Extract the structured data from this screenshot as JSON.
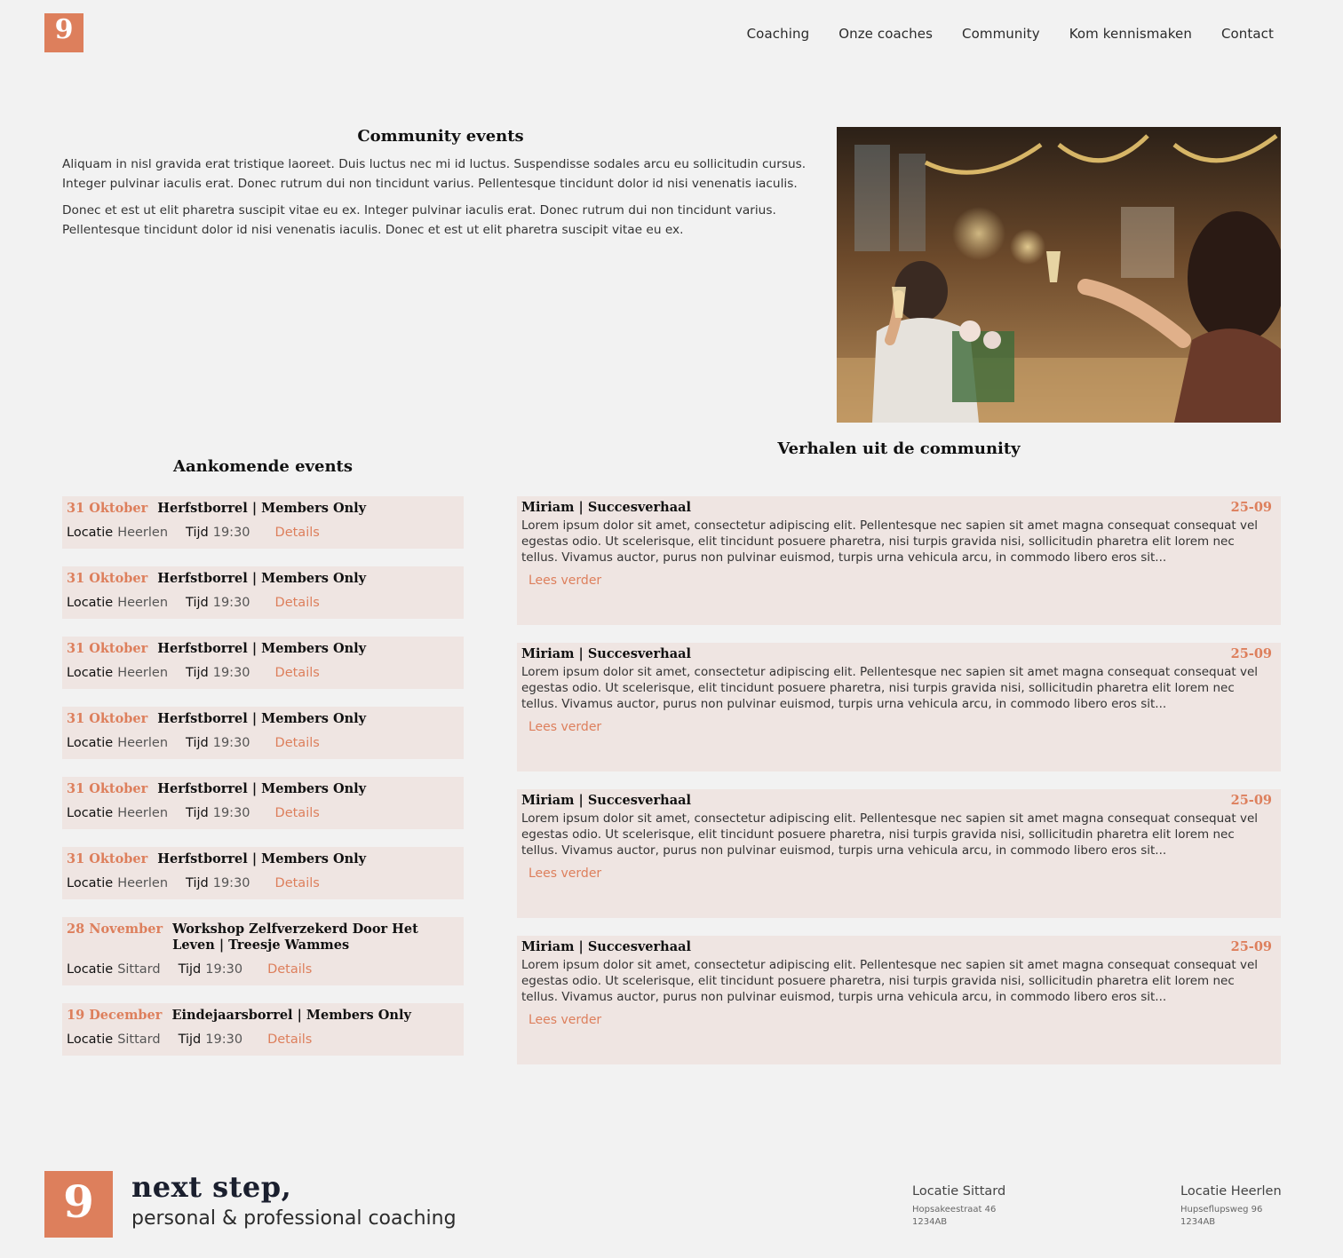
{
  "header": {
    "logo_glyph": "9",
    "nav": [
      "Coaching",
      "Onze coaches",
      "Community",
      "Kom kennismaken",
      "Contact"
    ]
  },
  "intro": {
    "title": "Community events",
    "paragraphs": [
      "Aliquam in nisl gravida erat tristique laoreet. Duis luctus nec mi id luctus. Suspendisse sodales arcu eu sollicitudin cursus. Integer pulvinar iaculis erat. Donec rutrum dui non tincidunt varius. Pellentesque tincidunt dolor id nisi venenatis iaculis.",
      "Donec et est ut elit pharetra suscipit vitae eu ex. Integer pulvinar iaculis erat. Donec rutrum dui non tincidunt varius. Pellentesque tincidunt dolor id nisi venenatis iaculis. Donec et est ut elit pharetra suscipit vitae eu ex."
    ]
  },
  "events": {
    "title": "Aankomende events",
    "label_location": "Locatie",
    "label_time": "Tijd",
    "details_label": "Details",
    "items": [
      {
        "date": "31 Oktober",
        "name": "Herfstborrel | Members Only",
        "location": "Heerlen",
        "time": "19:30"
      },
      {
        "date": "31 Oktober",
        "name": "Herfstborrel | Members Only",
        "location": "Heerlen",
        "time": "19:30"
      },
      {
        "date": "31 Oktober",
        "name": "Herfstborrel | Members Only",
        "location": "Heerlen",
        "time": "19:30"
      },
      {
        "date": "31 Oktober",
        "name": "Herfstborrel | Members Only",
        "location": "Heerlen",
        "time": "19:30"
      },
      {
        "date": "31 Oktober",
        "name": "Herfstborrel | Members Only",
        "location": "Heerlen",
        "time": "19:30"
      },
      {
        "date": "31 Oktober",
        "name": "Herfstborrel | Members Only",
        "location": "Heerlen",
        "time": "19:30"
      },
      {
        "date": "28 November",
        "name": "Workshop Zelfverzekerd Door Het Leven | Treesje Wammes",
        "location": "Sittard",
        "time": "19:30"
      },
      {
        "date": "19 December",
        "name": "Eindejaarsborrel | Members Only",
        "location": "Sittard",
        "time": "19:30"
      }
    ]
  },
  "stories": {
    "title": "Verhalen uit de community",
    "read_more": "Lees verder",
    "items": [
      {
        "author": "Miriam | Succesverhaal",
        "date": "25-09",
        "text": "Lorem ipsum dolor sit amet, consectetur adipiscing elit. Pellentesque nec sapien sit amet magna consequat consequat vel egestas odio. Ut scelerisque, elit tincidunt posuere pharetra, nisi turpis gravida nisi, sollicitudin pharetra elit lorem nec tellus. Vivamus auctor, purus non pulvinar euismod, turpis urna vehicula arcu, in commodo libero eros sit..."
      },
      {
        "author": "Miriam | Succesverhaal",
        "date": "25-09",
        "text": "Lorem ipsum dolor sit amet, consectetur adipiscing elit. Pellentesque nec sapien sit amet magna consequat consequat vel egestas odio. Ut scelerisque, elit tincidunt posuere pharetra, nisi turpis gravida nisi, sollicitudin pharetra elit lorem nec tellus. Vivamus auctor, purus non pulvinar euismod, turpis urna vehicula arcu, in commodo libero eros sit..."
      },
      {
        "author": "Miriam | Succesverhaal",
        "date": "25-09",
        "text": "Lorem ipsum dolor sit amet, consectetur adipiscing elit. Pellentesque nec sapien sit amet magna consequat consequat vel egestas odio. Ut scelerisque, elit tincidunt posuere pharetra, nisi turpis gravida nisi, sollicitudin pharetra elit lorem nec tellus. Vivamus auctor, purus non pulvinar euismod, turpis urna vehicula arcu, in commodo libero eros sit..."
      },
      {
        "author": "Miriam | Succesverhaal",
        "date": "25-09",
        "text": "Lorem ipsum dolor sit amet, consectetur adipiscing elit. Pellentesque nec sapien sit amet magna consequat consequat vel egestas odio. Ut scelerisque, elit tincidunt posuere pharetra, nisi turpis gravida nisi, sollicitudin pharetra elit lorem nec tellus. Vivamus auctor, purus non pulvinar euismod, turpis urna vehicula arcu, in commodo libero eros sit..."
      }
    ]
  },
  "footer": {
    "brand_name": "next step,",
    "brand_sub": "personal & professional coaching",
    "locations": [
      {
        "title": "Locatie Sittard",
        "street": "Hopsakeestraat 46",
        "zip": "1234AB"
      },
      {
        "title": "Locatie Heerlen",
        "street": "Hupseflupsweg 96",
        "zip": "1234AB"
      }
    ]
  },
  "colors": {
    "accent": "#dd7f5c",
    "card": "#efe5e2",
    "background": "#f2f2f2"
  }
}
